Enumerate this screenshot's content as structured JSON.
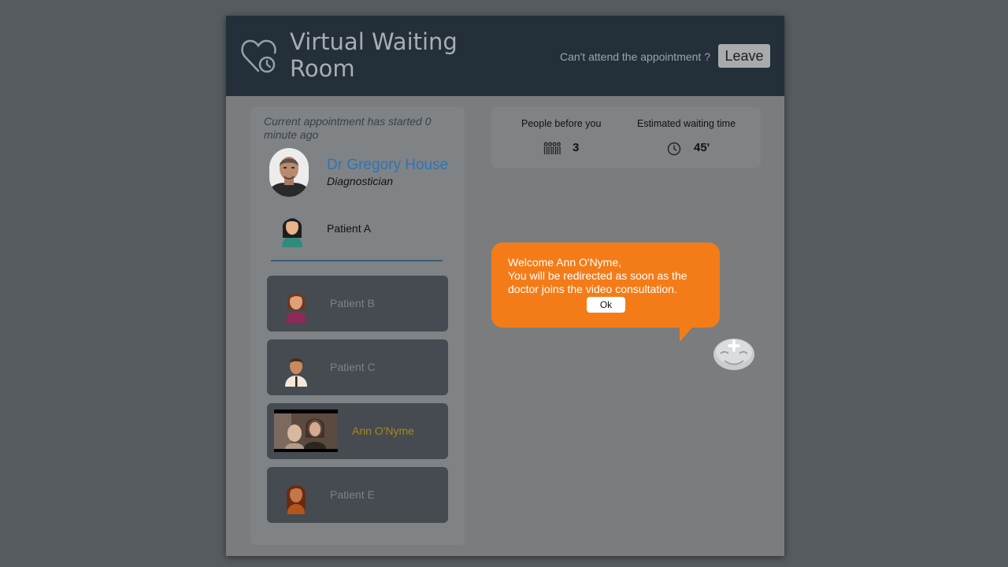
{
  "header": {
    "title": "Virtual Waiting Room",
    "cant_attend": "Can't attend the appointment ?",
    "leave_label": "Leave"
  },
  "appointment": {
    "started_text": "Current appointment has started 0 minute ago",
    "doctor_name": "Dr Gregory House",
    "doctor_role": "Diagnostician",
    "current_patient": "Patient A"
  },
  "queue": [
    {
      "name": "Patient B",
      "avatar": "female-avatar",
      "color": "#8e2a57"
    },
    {
      "name": "Patient C",
      "avatar": "male-avatar",
      "color": "#f3e6d6"
    },
    {
      "name": "Ann O'Nyme",
      "avatar": "video-feed",
      "color": "#a8861c"
    },
    {
      "name": "Patient E",
      "avatar": "female-avatar",
      "color": "#b4551c"
    }
  ],
  "stats": {
    "people_label": "People before you",
    "people_value": "3",
    "people_icon": "people-queue-icon",
    "wait_label": "Estimated waiting time",
    "wait_value": "45'",
    "wait_icon": "clock-icon"
  },
  "notice": {
    "line1": "Welcome Ann O'Nyme,",
    "line2": "You will be redirected as soon as the doctor joins the video consultation.",
    "ok_label": "Ok",
    "color": "#f47c18"
  },
  "colors": {
    "header_bg": "#232f39",
    "doctor_name": "#2e75b6",
    "highlight_name": "#a8861c"
  }
}
